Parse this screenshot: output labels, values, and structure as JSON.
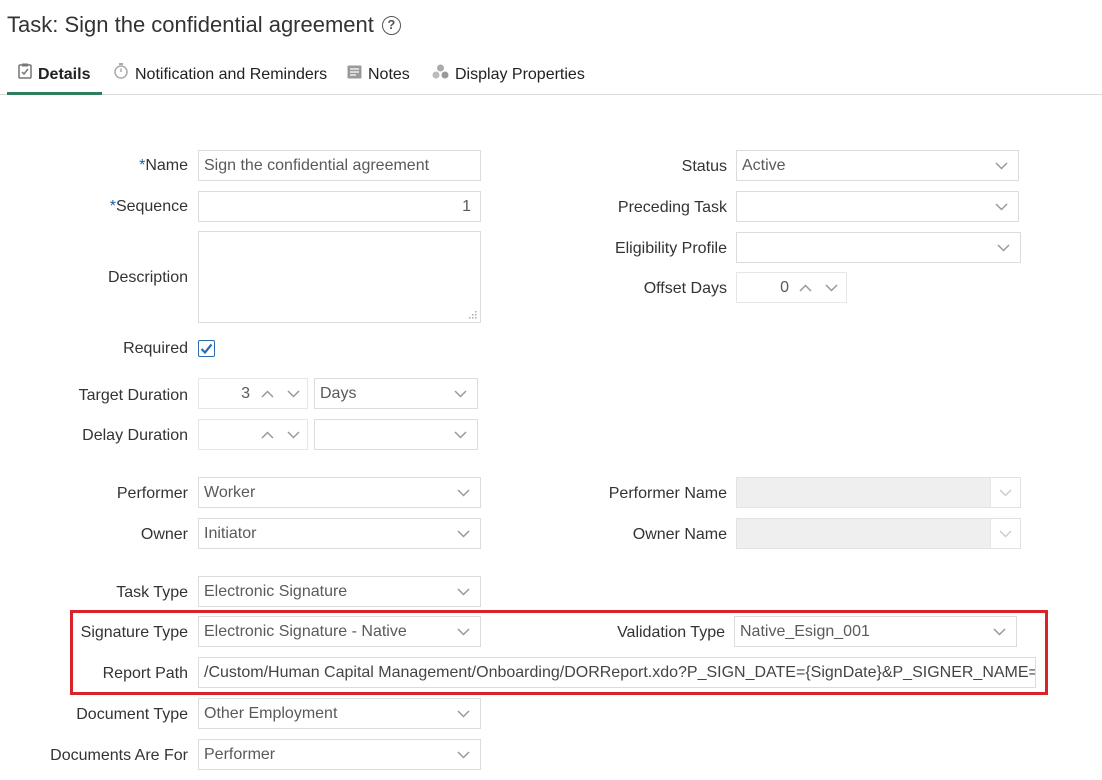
{
  "header": {
    "title": "Task: Sign the confidential agreement",
    "help_glyph": "?"
  },
  "tabs": [
    {
      "label": "Details",
      "icon": "clipboard-icon",
      "active": true
    },
    {
      "label": "Notification and Reminders",
      "icon": "stopwatch-icon",
      "active": false
    },
    {
      "label": "Notes",
      "icon": "notes-icon",
      "active": false
    },
    {
      "label": "Display Properties",
      "icon": "cluster-dots-icon",
      "active": false
    }
  ],
  "form": {
    "name": {
      "label": "Name",
      "required_mark": "*",
      "value": "Sign the confidential agreement"
    },
    "sequence": {
      "label": "Sequence",
      "required_mark": "*",
      "value": "1"
    },
    "description": {
      "label": "Description",
      "value": ""
    },
    "required": {
      "label": "Required",
      "checked": true
    },
    "target_duration": {
      "label": "Target Duration",
      "value": "3",
      "unit": "Days"
    },
    "delay_duration": {
      "label": "Delay Duration",
      "value": "",
      "unit": ""
    },
    "status": {
      "label": "Status",
      "value": "Active"
    },
    "preceding_task": {
      "label": "Preceding Task",
      "value": ""
    },
    "eligibility_profile": {
      "label": "Eligibility Profile",
      "value": ""
    },
    "offset_days": {
      "label": "Offset Days",
      "value": "0"
    },
    "performer": {
      "label": "Performer",
      "value": "Worker"
    },
    "owner": {
      "label": "Owner",
      "value": "Initiator"
    },
    "performer_name": {
      "label": "Performer Name",
      "value": ""
    },
    "owner_name": {
      "label": "Owner Name",
      "value": ""
    },
    "task_type": {
      "label": "Task Type",
      "value": "Electronic Signature"
    },
    "signature_type": {
      "label": "Signature Type",
      "value": "Electronic Signature - Native"
    },
    "validation_type": {
      "label": "Validation Type",
      "value": "Native_Esign_001"
    },
    "report_path": {
      "label": "Report Path",
      "value": "/Custom/Human Capital Management/Onboarding/DORReport.xdo?P_SIGN_DATE={SignDate}&P_SIGNER_NAME={Sig"
    },
    "document_type": {
      "label": "Document Type",
      "value": "Other Employment"
    },
    "documents_are_for": {
      "label": "Documents Are For",
      "value": "Performer"
    }
  },
  "colors": {
    "accent_tab": "#2e7d5b",
    "required_mark": "#1a5f9e",
    "highlight": "#d9232c",
    "checkbox": "#2b6cb0"
  }
}
